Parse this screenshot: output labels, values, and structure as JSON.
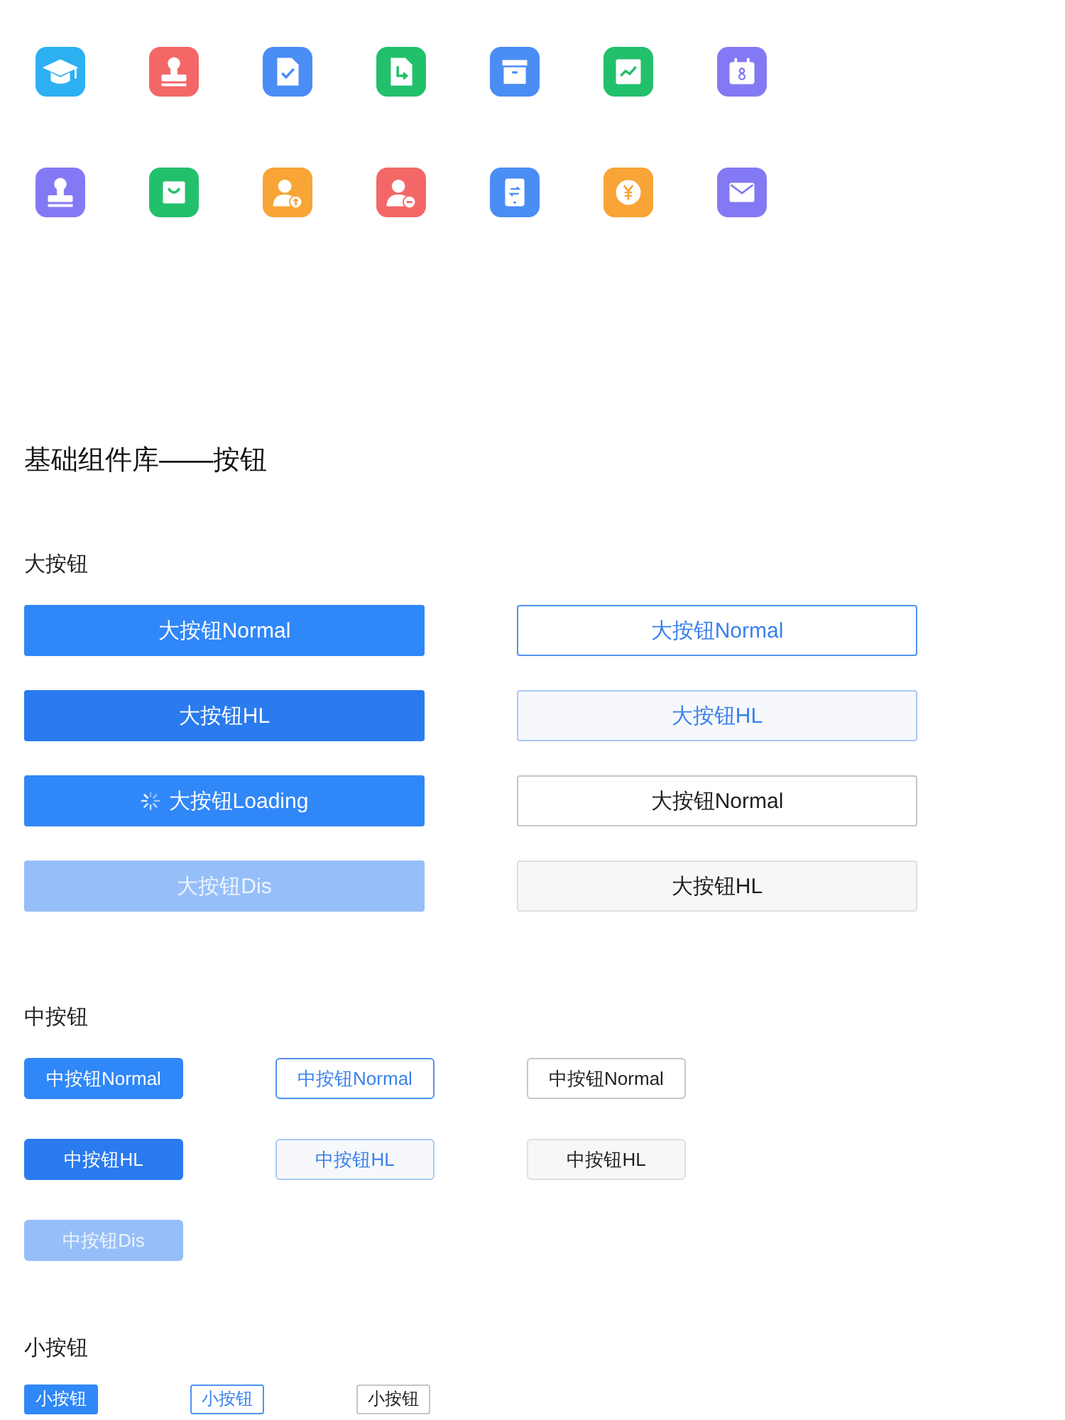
{
  "title": "基础组件库——按钮",
  "sections": [
    {
      "label": "大按钮",
      "kind": "large",
      "rows": [
        [
          {
            "text": "大按钮Normal",
            "kind": "primary",
            "highlighted": false,
            "disabled": false,
            "loading": false
          },
          {
            "text": "大按钮Normal",
            "kind": "outline",
            "highlighted": false,
            "disabled": false,
            "loading": false
          }
        ],
        [
          {
            "text": "大按钮HL",
            "kind": "primary",
            "highlighted": true,
            "disabled": false,
            "loading": false
          },
          {
            "text": "大按钮HL",
            "kind": "outline",
            "highlighted": true,
            "disabled": false,
            "loading": false
          }
        ],
        [
          {
            "text": "大按钮Loading",
            "kind": "primary",
            "highlighted": false,
            "disabled": false,
            "loading": true
          },
          {
            "text": "大按钮Normal",
            "kind": "plain",
            "highlighted": false,
            "disabled": false,
            "loading": false
          }
        ],
        [
          {
            "text": "大按钮Dis",
            "kind": "primary",
            "highlighted": false,
            "disabled": true,
            "loading": false
          },
          {
            "text": "大按钮HL",
            "kind": "plain",
            "highlighted": true,
            "disabled": false,
            "loading": false
          }
        ]
      ]
    },
    {
      "label": "中按钮",
      "kind": "medium",
      "rows": [
        [
          {
            "text": "中按钮Normal",
            "kind": "primary",
            "highlighted": false,
            "disabled": false,
            "loading": false
          },
          {
            "text": "中按钮Normal",
            "kind": "outline",
            "highlighted": false,
            "disabled": false,
            "loading": false
          },
          {
            "text": "中按钮Normal",
            "kind": "plain",
            "highlighted": false,
            "disabled": false,
            "loading": false
          }
        ],
        [
          {
            "text": "中按钮HL",
            "kind": "primary",
            "highlighted": true,
            "disabled": false,
            "loading": false
          },
          {
            "text": "中按钮HL",
            "kind": "outline",
            "highlighted": true,
            "disabled": false,
            "loading": false
          },
          {
            "text": "中按钮HL",
            "kind": "plain",
            "highlighted": true,
            "disabled": false,
            "loading": false
          }
        ],
        [
          {
            "text": "中按钮Dis",
            "kind": "primary",
            "highlighted": false,
            "disabled": true,
            "loading": false
          }
        ]
      ]
    },
    {
      "label": "小按钮",
      "kind": "small",
      "rows": [
        [
          {
            "text": "小按钮",
            "kind": "primary",
            "highlighted": false,
            "disabled": false,
            "loading": false
          },
          {
            "text": "小按钮",
            "kind": "outline",
            "highlighted": false,
            "disabled": false,
            "loading": false
          },
          {
            "text": "小按钮",
            "kind": "plain",
            "highlighted": false,
            "disabled": false,
            "loading": false
          }
        ]
      ]
    }
  ]
}
